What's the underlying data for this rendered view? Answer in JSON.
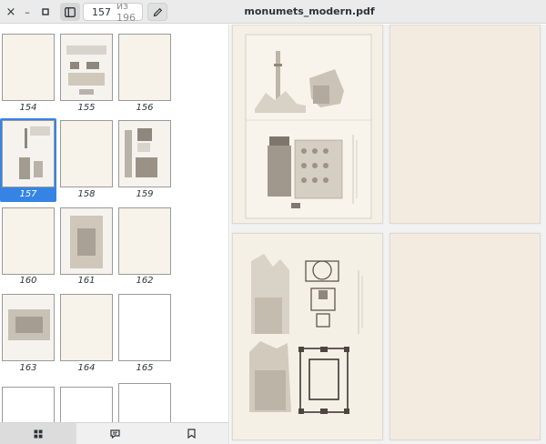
{
  "window": {
    "title": "monumets_modern.pdf"
  },
  "header": {
    "close_glyph": "×",
    "minimize_glyph": "–",
    "maximize_glyph": "▫",
    "current_page": "157",
    "total_pages": "из 196",
    "icons": [
      "close-icon",
      "minimize-icon",
      "maximize-icon",
      "sidebar-toggle-icon",
      "pencil-icon"
    ]
  },
  "sidebar": {
    "thumbnails": [
      "154",
      "155",
      "156",
      "157",
      "158",
      "159",
      "160",
      "161",
      "162",
      "163",
      "164",
      "165"
    ],
    "selected": "157",
    "footer_tabs": [
      "thumbnails-icon",
      "annotations-icon",
      "bookmarks-icon"
    ],
    "accent": "#3584e4"
  }
}
